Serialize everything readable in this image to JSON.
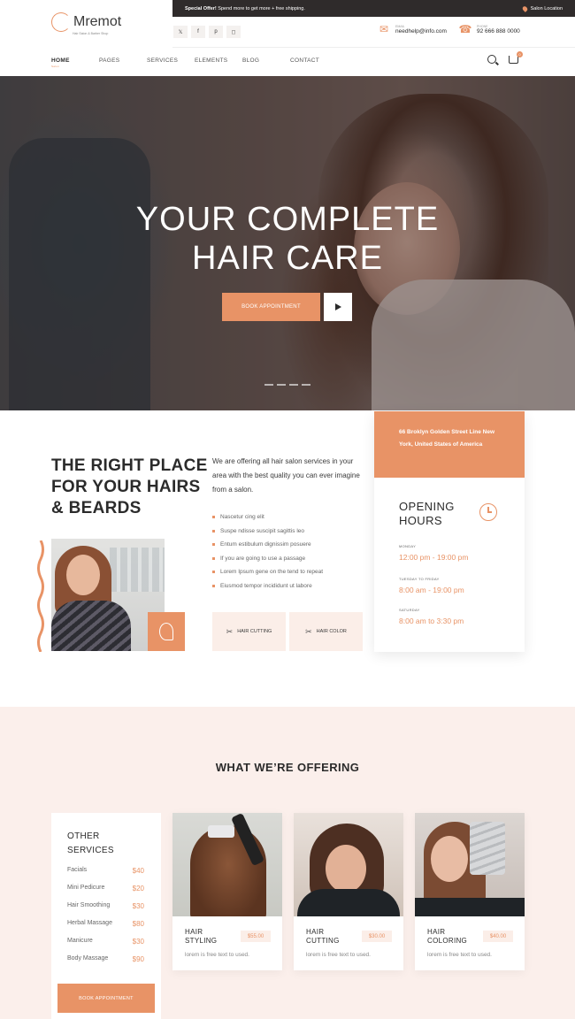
{
  "topbar": {
    "offer_bold": "Special Offer!",
    "offer_text": "Spend more to get more + free shipping.",
    "location": "Salon Location"
  },
  "brand": {
    "name": "Mremot",
    "tagline": "Hair Salon & Barber Shop"
  },
  "socials": [
    "twitter-icon",
    "facebook-icon",
    "pinterest-icon",
    "instagram-icon"
  ],
  "contact": {
    "email_label": "EMAIL",
    "email": "needhelp@info.com",
    "phone_label": "PHONE",
    "phone": "92 666 888 0000"
  },
  "nav": {
    "items": [
      "HOME",
      "PAGES",
      "SERVICES",
      "ELEMENTS",
      "BLOG",
      "CONTACT"
    ],
    "active_sub": "Salon",
    "cart_count": "0"
  },
  "hero": {
    "line1": "YOUR COMPLETE",
    "line2": "HAIR CARE",
    "cta": "BOOK APPOINTMENT"
  },
  "about": {
    "title_lines": [
      "THE RIGHT PLACE",
      "FOR YOUR HAIRS",
      "& BEARDS"
    ],
    "intro": "We are offering all hair salon services in your area with the best quality you can ever imagine from a salon.",
    "list": [
      "Nascetur cing elit",
      "Suspe ndisse suscipit sagittis leo",
      "Entum estibulum dignissim posuere",
      "If you are going to use a passage",
      "Lorem Ipsum gene on the tend to repeat",
      "Eiusmod tempor incididunt ut labore"
    ],
    "btn_cutting": "HAIR CUTTING",
    "btn_color": "HAIR COLOR"
  },
  "hours": {
    "address": "66 Broklyn Golden Street Line New York, United States of America",
    "title_line1": "OPENING",
    "title_line2": "HOURS",
    "schedule": [
      {
        "day": "MONDAY",
        "time": "12:00 pm - 19:00 pm"
      },
      {
        "day": "TUESDAY TO FRIDAY",
        "time": "8:00 am - 19:00 pm"
      },
      {
        "day": "SATURDAY",
        "time": "8:00 am to 3:30 pm"
      }
    ]
  },
  "offering": {
    "title": "WHAT WE’RE OFFERING",
    "other_title_line1": "OTHER",
    "other_title_line2": "SERVICES",
    "other_services": [
      {
        "name": "Facials",
        "price": "$40"
      },
      {
        "name": "Mini Pedicure",
        "price": "$20"
      },
      {
        "name": "Hair Smoothing",
        "price": "$30"
      },
      {
        "name": "Herbal Massage",
        "price": "$80"
      },
      {
        "name": "Manicure",
        "price": "$30"
      },
      {
        "name": "Body Massage",
        "price": "$90"
      }
    ],
    "other_cta": "BOOK APPOINTMENT",
    "cards": [
      {
        "line1": "HAIR",
        "line2": "STYLING",
        "price": "$55.00",
        "desc": "lorem is free text to used."
      },
      {
        "line1": "HAIR",
        "line2": "CUTTING",
        "price": "$30.00",
        "desc": "lorem is free text to used."
      },
      {
        "line1": "HAIR",
        "line2": "COLORING",
        "price": "$40.00",
        "desc": "lorem is free text to used."
      }
    ]
  },
  "colors": {
    "accent": "#e89366",
    "dark": "#2f2b2b",
    "blush": "#fbefeb"
  }
}
